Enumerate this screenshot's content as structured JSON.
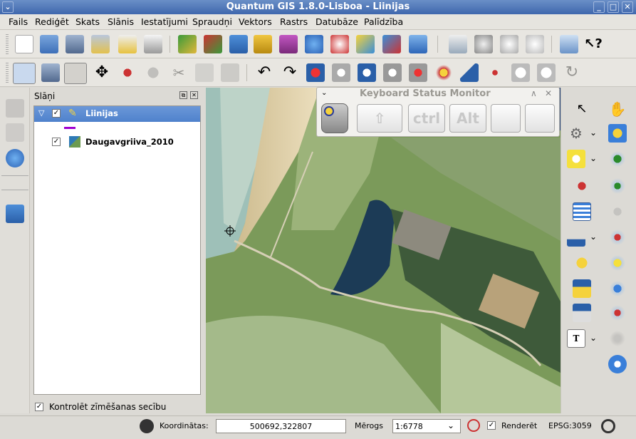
{
  "window": {
    "title": "Quantum GIS 1.8.0-Lisboa - Liinijas"
  },
  "menu": {
    "items": [
      "Fails",
      "Rediģēt",
      "Skats",
      "Slānis",
      "Iestatījumi",
      "Spraudņi",
      "Vektors",
      "Rastrs",
      "Datubāze",
      "Palīdzība"
    ]
  },
  "layers_panel": {
    "title": "Slāņi",
    "layers": [
      {
        "name": "Liinijas",
        "checked": true,
        "selected": true,
        "legend_color": "#a000d0"
      },
      {
        "name": "Daugavgriiva_2010",
        "checked": true,
        "selected": false
      }
    ],
    "render_order_label": "Kontrolēt zīmēšanas secību"
  },
  "keyboard_monitor": {
    "title": "Keyboard Status Monitor",
    "keys": [
      "ctrl",
      "Alt"
    ]
  },
  "status": {
    "coord_label": "Koordinātas:",
    "coord_value": "500692,322807",
    "scale_label": "Mērogs",
    "scale_value": "1:6778",
    "render_label": "Renderēt",
    "crs": "EPSG:3059"
  },
  "colors": {
    "accent": "#3f67ad",
    "selection": "#4f82cc",
    "legend": "#a000d0"
  }
}
